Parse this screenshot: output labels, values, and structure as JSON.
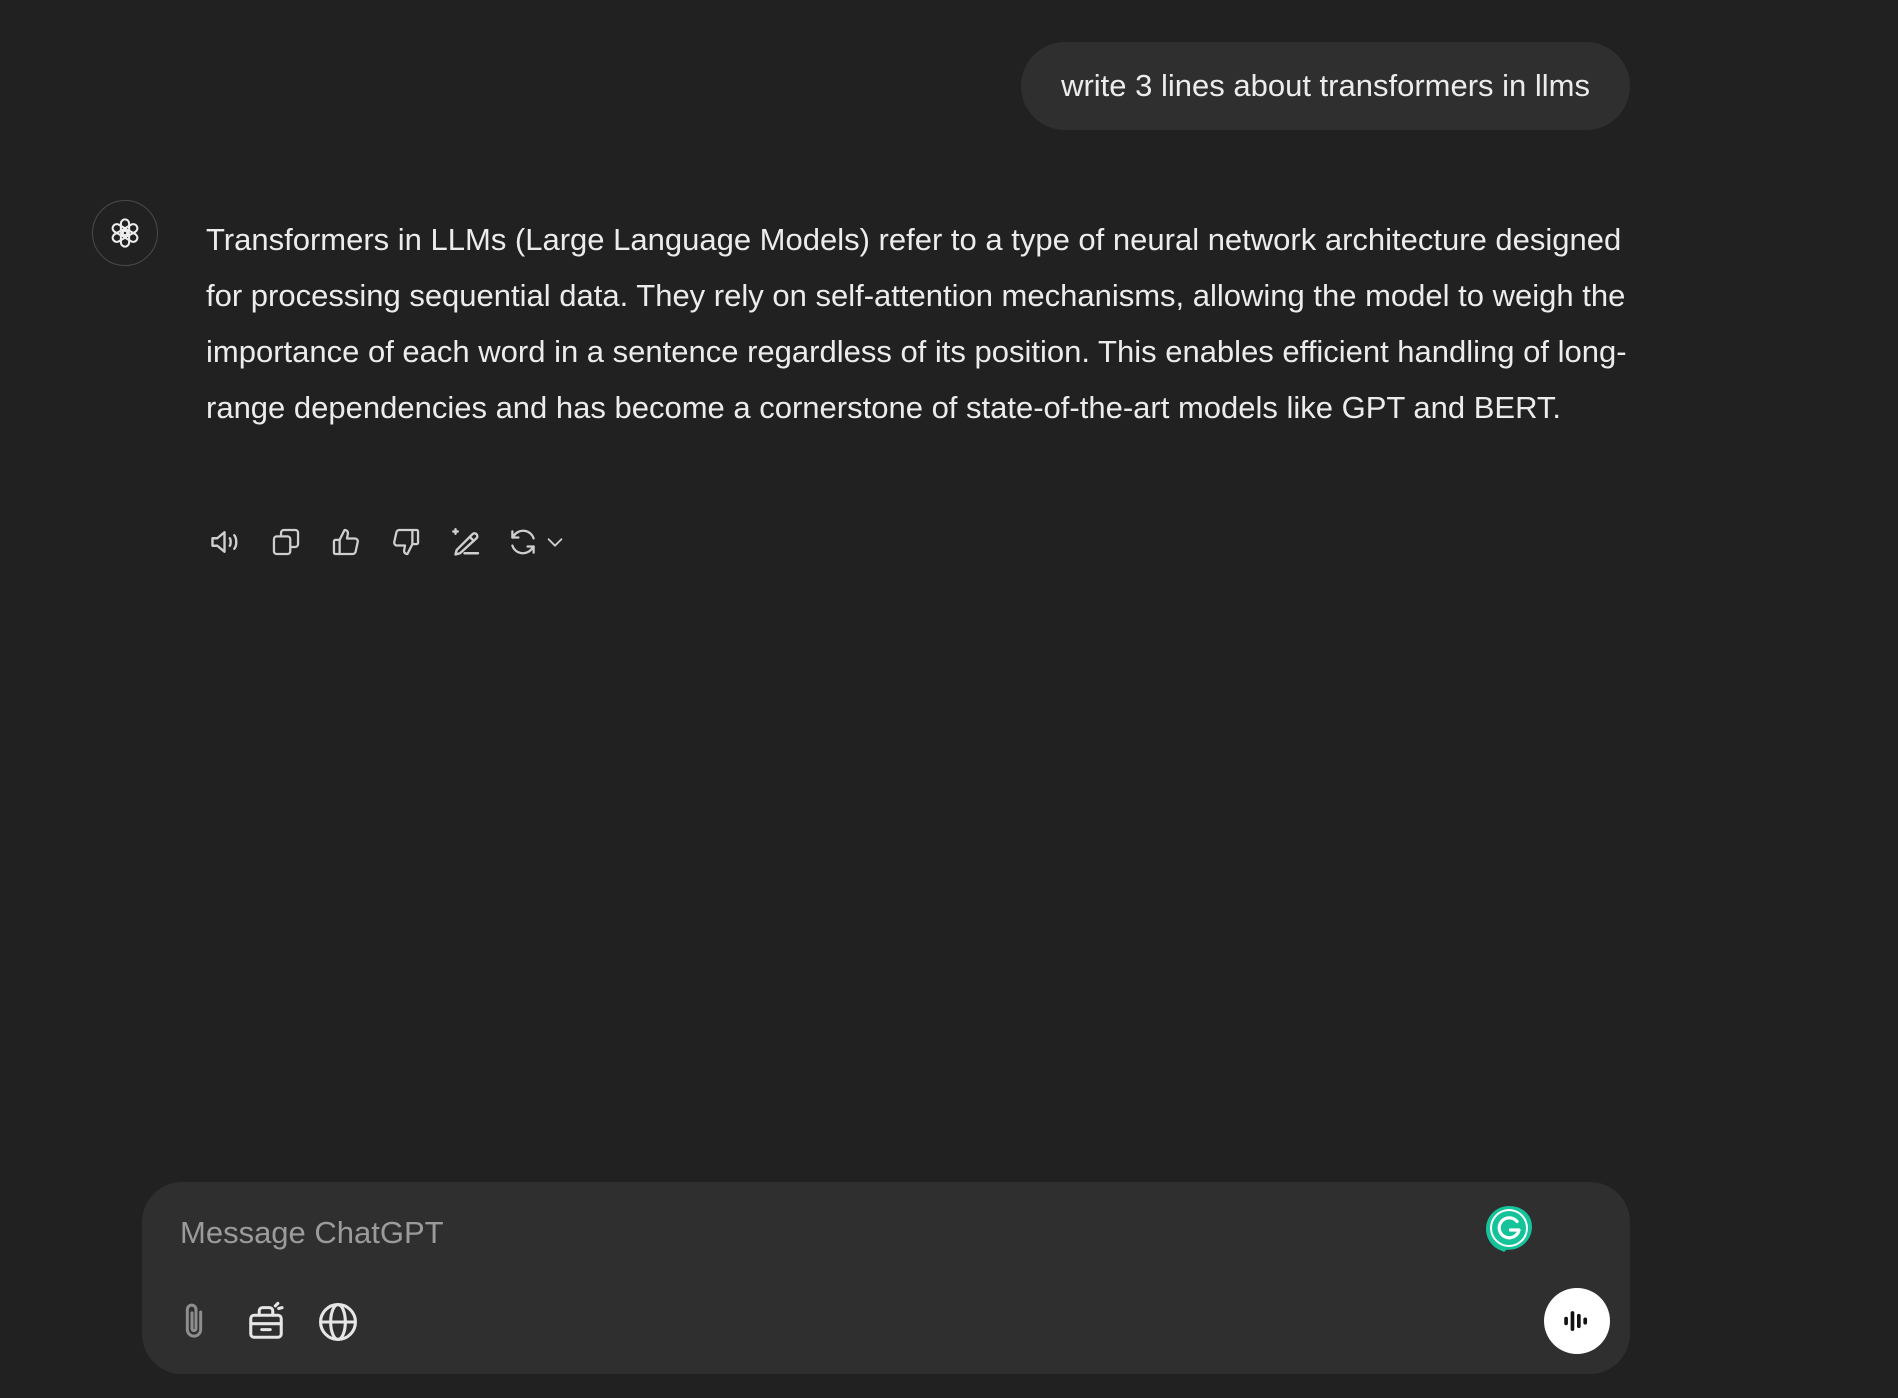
{
  "conversation": {
    "user_message": "write 3 lines about transformers in llms",
    "assistant_message": "Transformers in LLMs (Large Language Models) refer to a type of neural network architecture designed for processing sequential data. They rely on self-attention mechanisms, allowing the model to weigh the importance of each word in a sentence regardless of its position. This enables efficient handling of long-range dependencies and has become a cornerstone of state-of-the-art models like GPT and BERT.",
    "assistant_avatar_icon": "openai-logo-icon"
  },
  "message_actions": [
    {
      "icon": "speaker-icon"
    },
    {
      "icon": "copy-icon"
    },
    {
      "icon": "thumbs-up-icon"
    },
    {
      "icon": "thumbs-down-icon"
    },
    {
      "icon": "edit-sparkle-icon"
    },
    {
      "icon": "regenerate-icon"
    }
  ],
  "composer": {
    "placeholder": "Message ChatGPT",
    "value": "",
    "tools": [
      {
        "icon": "paperclip-icon"
      },
      {
        "icon": "toolbox-icon"
      },
      {
        "icon": "globe-icon"
      }
    ],
    "extension_icon": "grammarly-icon",
    "voice_icon": "voice-waveform-icon"
  },
  "colors": {
    "background": "#212121",
    "bubble": "#2f2f2f",
    "text": "#ececec",
    "placeholder": "#9b9b9b",
    "grammarly": "#15c39a"
  }
}
